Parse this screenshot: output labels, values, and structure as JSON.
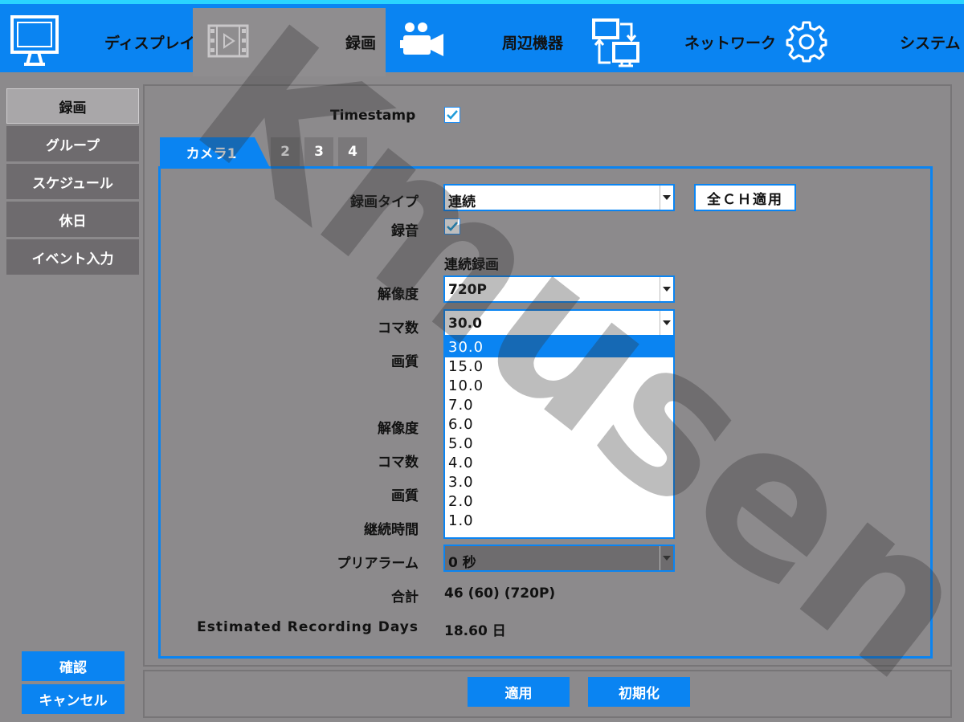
{
  "topbar": {
    "items": [
      {
        "label": "ディスプレイ",
        "icon": "monitor-icon"
      },
      {
        "label": "録画",
        "icon": "film-icon"
      },
      {
        "label": "周辺機器",
        "icon": "video-camera-icon"
      },
      {
        "label": "ネットワーク",
        "icon": "network-icon"
      },
      {
        "label": "システム",
        "icon": "gear-icon"
      }
    ]
  },
  "sidebar": {
    "items": [
      "録画",
      "グループ",
      "スケジュール",
      "休日",
      "イベント入力"
    ]
  },
  "form": {
    "timestamp_label": "Timestamp",
    "timestamp_checked": true,
    "tabs": [
      "カメラ1",
      "2",
      "3",
      "4"
    ],
    "record_type_label": "録画タイプ",
    "record_type_value": "連続",
    "apply_all_label": "全ＣＨ適用",
    "audio_label": "録音",
    "audio_checked": true,
    "continuous_heading": "連続録画",
    "resolution_label": "解像度",
    "resolution_value": "720P",
    "framerate_label": "コマ数",
    "framerate_value": "30.0",
    "quality_label": "画質",
    "resolution2_label": "解像度",
    "framerate2_label": "コマ数",
    "quality2_label": "画質",
    "duration_label": "継続時間",
    "prealarm_label": "プリアラーム",
    "prealarm_value": "0 秒",
    "total_label": "合計",
    "total_value": "46 (60) (720P)",
    "est_days_label": "Estimated Recording Days",
    "est_days_value": "18.60 日"
  },
  "dropdown": {
    "options": [
      "30.0",
      "15.0",
      "10.0",
      "7.0",
      "6.0",
      "5.0",
      "4.0",
      "3.0",
      "2.0",
      "1.0"
    ],
    "selected": "30.0"
  },
  "buttons": {
    "confirm": "確認",
    "cancel": "キャンセル",
    "apply": "適用",
    "reset": "初期化"
  },
  "watermark": "Kmusen",
  "colors": {
    "accent": "#0a84f2",
    "top_border": "#2ad4ff",
    "background": "#8c8a8c"
  }
}
